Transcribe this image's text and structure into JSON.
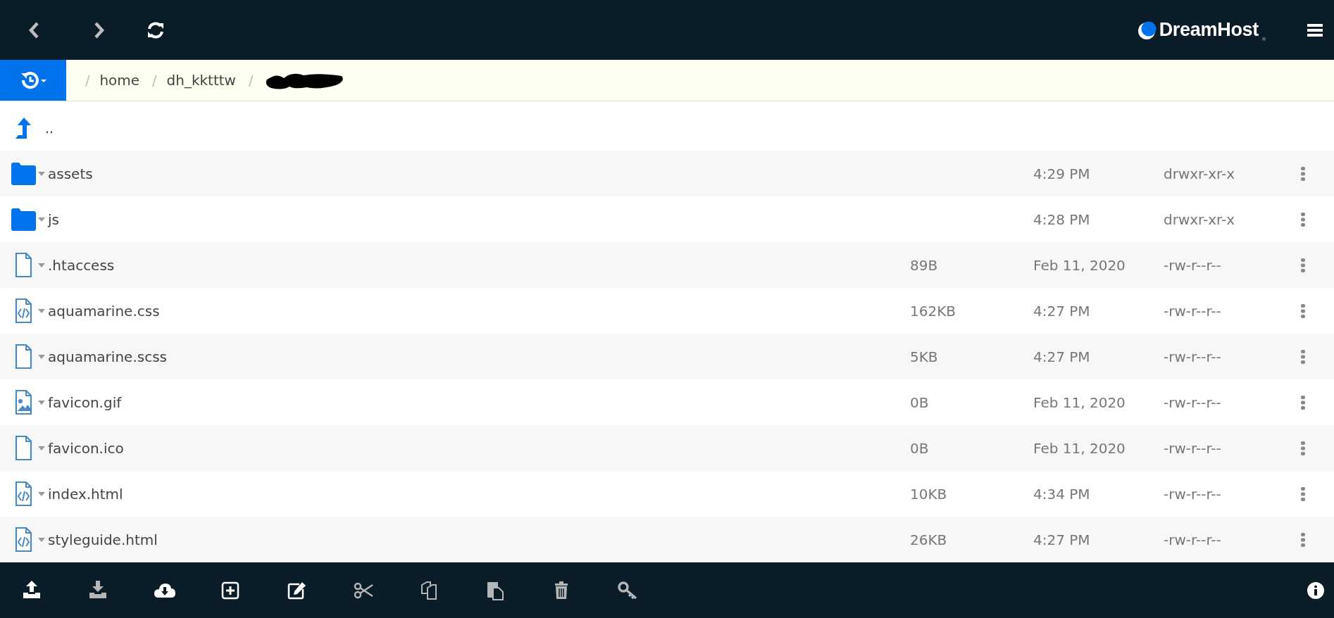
{
  "top_bar": {
    "logo": "DreamHost",
    "logo_mark": "®"
  },
  "breadcrumb": {
    "items": [
      {
        "kind": "text",
        "separator": "/",
        "label": "home"
      },
      {
        "kind": "text",
        "separator": "/",
        "label": "dh_kktttw"
      },
      {
        "kind": "redacted",
        "separator": "/"
      }
    ]
  },
  "parent_row": {
    "label": ".."
  },
  "files": [
    {
      "kind": "folder",
      "name": "assets",
      "modified": "4:29 PM",
      "permissions": "drwxr-xr-x"
    },
    {
      "kind": "folder",
      "name": "js",
      "modified": "4:28 PM",
      "permissions": "drwxr-xr-x"
    },
    {
      "kind": "file",
      "name": ".htaccess",
      "size": "89B",
      "modified": "Feb 11, 2020",
      "permissions": "-rw-r--r--"
    },
    {
      "kind": "code",
      "name": "aquamarine.css",
      "size": "162KB",
      "modified": "4:27 PM",
      "permissions": "-rw-r--r--"
    },
    {
      "kind": "file",
      "name": "aquamarine.scss",
      "size": "5KB",
      "modified": "4:27 PM",
      "permissions": "-rw-r--r--"
    },
    {
      "kind": "image",
      "name": "favicon.gif",
      "size": "0B",
      "modified": "Feb 11, 2020",
      "permissions": "-rw-r--r--"
    },
    {
      "kind": "file",
      "name": "favicon.ico",
      "size": "0B",
      "modified": "Feb 11, 2020",
      "permissions": "-rw-r--r--"
    },
    {
      "kind": "code",
      "name": "index.html",
      "size": "10KB",
      "modified": "4:34 PM",
      "permissions": "-rw-r--r--"
    },
    {
      "kind": "code",
      "name": "styleguide.html",
      "size": "26KB",
      "modified": "4:27 PM",
      "permissions": "-rw-r--r--"
    }
  ],
  "toolbar": [
    {
      "kind": "upload",
      "disabled": false
    },
    {
      "kind": "download",
      "disabled": true
    },
    {
      "kind": "cloud",
      "disabled": false
    },
    {
      "kind": "create",
      "disabled": false
    },
    {
      "kind": "edit",
      "disabled": false
    },
    {
      "kind": "cut",
      "disabled": true
    },
    {
      "kind": "copy",
      "disabled": true
    },
    {
      "kind": "paste",
      "disabled": true
    },
    {
      "kind": "delete",
      "disabled": true
    },
    {
      "kind": "key",
      "disabled": true
    }
  ]
}
